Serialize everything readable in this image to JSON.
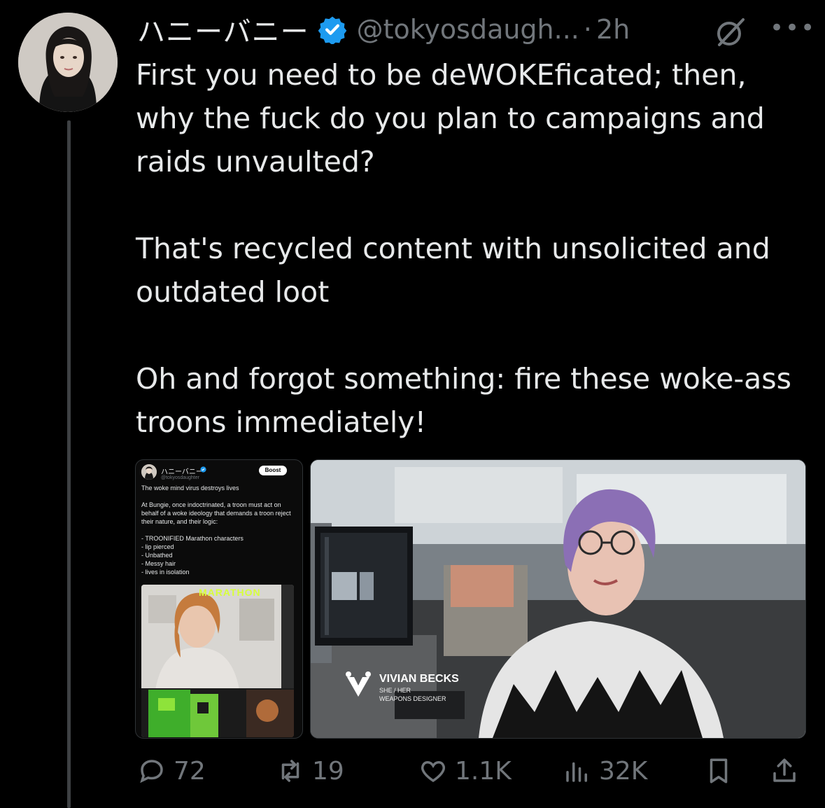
{
  "author": {
    "display_name": "ハニーバニー",
    "handle": "@tokyosdaugh...",
    "separator": "·",
    "time": "2h",
    "verified_color": "#1d9bf0"
  },
  "tweet": {
    "paragraphs": [
      "First you need to be deWOKEficated; then, why the fuck do you plan to  campaigns and raids unvaulted?",
      "That's recycled content with unsolicited and outdated loot",
      "Oh and forgot something: fire these woke-ass troons immediately!"
    ]
  },
  "media_left": {
    "name": "ハニーバニー",
    "handle": "@tokyosdaughter",
    "boost_label": "Boost",
    "line1": "The woke mind virus destroys lives",
    "line2": "At Bungie, once indoctrinated, a troon must act on behalf of a woke ideology that demands a troon reject their nature, and their logic:",
    "line3": "- TROONIFIED Marathon characters\n- lip pierced\n- Unbathed\n- Messy hair\n- lives in isolation",
    "overlay_text": "MARATHON"
  },
  "media_right": {
    "name": "VIVIAN BECKS",
    "pronouns": "SHE / HER",
    "role": "WEAPONS DESIGNER"
  },
  "actions": {
    "replies": "72",
    "reposts": "19",
    "likes": "1.1K",
    "views": "32K"
  },
  "icons": [
    "verified-badge-icon",
    "grok-icon",
    "more-icon",
    "reply-icon",
    "repost-icon",
    "like-icon",
    "views-icon",
    "bookmark-icon",
    "share-icon"
  ]
}
